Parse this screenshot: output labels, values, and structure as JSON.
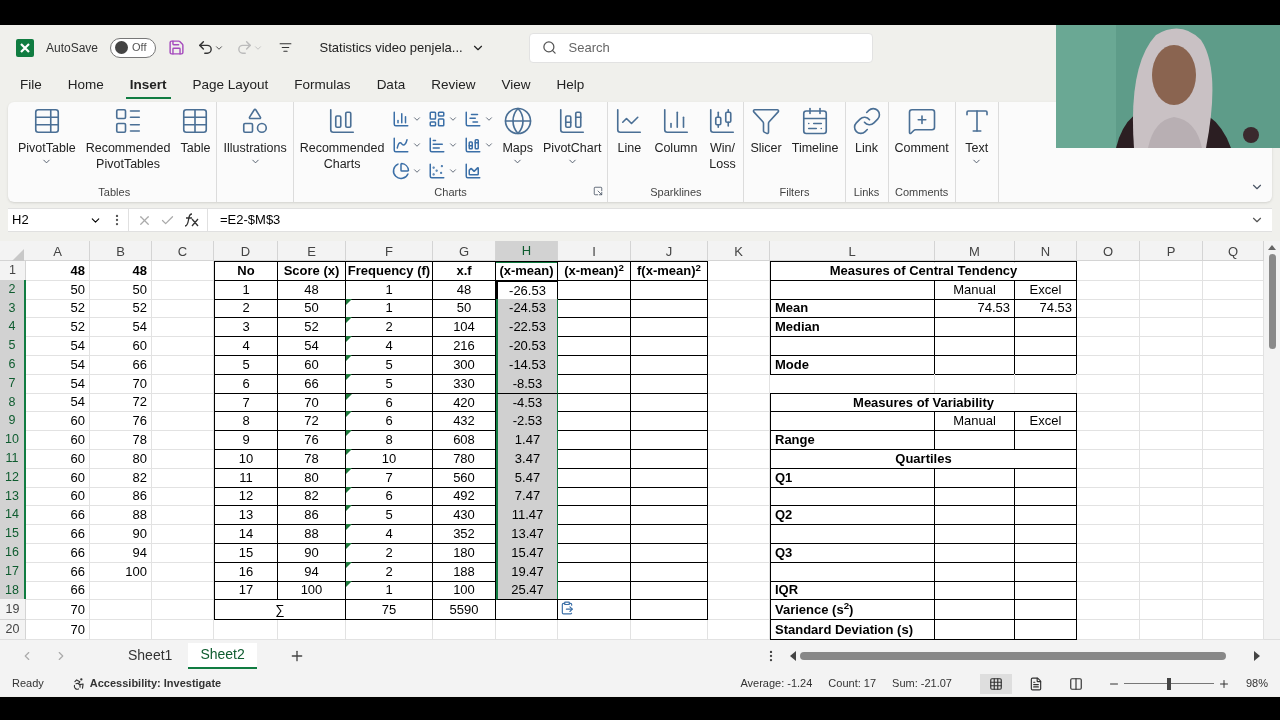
{
  "title_bar": {
    "autosave": {
      "label": "AutoSave",
      "on": false,
      "state_text": "Off"
    },
    "redo_disabled": true,
    "document": "Statistics video penjela...",
    "search": {
      "placeholder": "Search"
    }
  },
  "tabs": [
    {
      "label": "File",
      "selected": false
    },
    {
      "label": "Home",
      "selected": false
    },
    {
      "label": "Insert",
      "selected": true
    },
    {
      "label": "Page Layout",
      "selected": false
    },
    {
      "label": "Formulas",
      "selected": false
    },
    {
      "label": "Data",
      "selected": false
    },
    {
      "label": "Review",
      "selected": false
    },
    {
      "label": "View",
      "selected": false
    },
    {
      "label": "Help",
      "selected": false
    }
  ],
  "ribbon": {
    "groups": [
      {
        "label": "Tables",
        "items": [
          {
            "kind": "large",
            "label": "PivotTable",
            "dropdown": true
          },
          {
            "kind": "large",
            "label": "Recommended PivotTables",
            "dropdown": false
          },
          {
            "kind": "large",
            "label": "Table",
            "dropdown": false
          }
        ]
      },
      {
        "items": [
          {
            "kind": "large",
            "label": "Illustrations",
            "dropdown": true
          }
        ]
      },
      {
        "label": "Charts",
        "launcher": true,
        "items": [
          {
            "kind": "large",
            "label": "Recommended Charts",
            "dropdown": false
          },
          {
            "kind": "small",
            "dropdown": true
          },
          {
            "kind": "small",
            "dropdown": true
          },
          {
            "kind": "small",
            "dropdown": true
          },
          {
            "kind": "small",
            "dropdown": true
          },
          {
            "kind": "small",
            "dropdown": true
          },
          {
            "kind": "small",
            "dropdown": true
          },
          {
            "kind": "small",
            "dropdown": true
          },
          {
            "kind": "small",
            "dropdown": true
          },
          {
            "kind": "small",
            "dropdown": false
          },
          {
            "kind": "large",
            "label": "Maps",
            "dropdown": true
          },
          {
            "kind": "large",
            "label": "PivotChart",
            "dropdown": true
          }
        ]
      },
      {
        "label": "Sparklines",
        "items": [
          {
            "kind": "large",
            "label": "Line",
            "dropdown": false
          },
          {
            "kind": "large",
            "label": "Column",
            "dropdown": false
          },
          {
            "kind": "large",
            "label": "Win/ Loss",
            "dropdown": false
          }
        ]
      },
      {
        "label": "Filters",
        "items": [
          {
            "kind": "large",
            "label": "Slicer",
            "dropdown": false
          },
          {
            "kind": "large",
            "label": "Timeline",
            "dropdown": false
          }
        ]
      },
      {
        "label": "Links",
        "items": [
          {
            "kind": "large",
            "label": "Link",
            "dropdown": false
          }
        ]
      },
      {
        "label": "Comments",
        "items": [
          {
            "kind": "large",
            "label": "Comment",
            "dropdown": false
          }
        ]
      },
      {
        "items": [
          {
            "kind": "large",
            "label": "Text",
            "dropdown": true
          }
        ]
      }
    ]
  },
  "formula_bar": {
    "name_box": "H2",
    "formula": "=E2-$M$3"
  },
  "sheet": {
    "columns": [
      {
        "label": "A",
        "selected": false
      },
      {
        "label": "B",
        "selected": false
      },
      {
        "label": "C",
        "selected": false
      },
      {
        "label": "D",
        "selected": false
      },
      {
        "label": "E",
        "selected": false
      },
      {
        "label": "F",
        "selected": false
      },
      {
        "label": "G",
        "selected": false
      },
      {
        "label": "H",
        "selected": true
      },
      {
        "label": "I",
        "selected": false
      },
      {
        "label": "J",
        "selected": false
      },
      {
        "label": "K",
        "selected": false
      },
      {
        "label": "L",
        "selected": false
      },
      {
        "label": "M",
        "selected": false
      },
      {
        "label": "N",
        "selected": false
      },
      {
        "label": "O",
        "selected": false
      },
      {
        "label": "P",
        "selected": false
      },
      {
        "label": "Q",
        "selected": false
      }
    ],
    "rows": [
      {
        "number": "1",
        "selected": false,
        "active": false,
        "flag": false,
        "cells": [
          "48",
          "48",
          null,
          "No",
          "Score (x)",
          "Frequency (f)",
          "x.f",
          "(x-mean)",
          "(x-mean)$^{2}$",
          "f(x-mean)$^{2}$",
          null,
          "Measures of Central Tendency",
          null,
          null,
          null,
          null,
          null
        ]
      },
      {
        "number": "2",
        "selected": true,
        "active": true,
        "flag": false,
        "cells": [
          "50",
          "50",
          null,
          "1",
          "48",
          "1",
          "48",
          "-26.53",
          null,
          null,
          null,
          null,
          "Manual",
          "Excel",
          null,
          null,
          null
        ]
      },
      {
        "number": "3",
        "selected": true,
        "active": false,
        "flag": true,
        "cells": [
          "52",
          "52",
          null,
          "2",
          "50",
          "1",
          "50",
          "-24.53",
          null,
          null,
          null,
          "Mean",
          "74.53",
          "74.53",
          null,
          null,
          null
        ]
      },
      {
        "number": "4",
        "selected": true,
        "active": false,
        "flag": true,
        "cells": [
          "52",
          "54",
          null,
          "3",
          "52",
          "2",
          "104",
          "-22.53",
          null,
          null,
          null,
          "Median",
          null,
          null,
          null,
          null,
          null
        ]
      },
      {
        "number": "5",
        "selected": true,
        "active": false,
        "flag": true,
        "cells": [
          "54",
          "60",
          null,
          "4",
          "54",
          "4",
          "216",
          "-20.53",
          null,
          null,
          null,
          null,
          null,
          null,
          null,
          null,
          null
        ]
      },
      {
        "number": "6",
        "selected": true,
        "active": false,
        "flag": true,
        "cells": [
          "54",
          "66",
          null,
          "5",
          "60",
          "5",
          "300",
          "-14.53",
          null,
          null,
          null,
          "Mode",
          null,
          null,
          null,
          null,
          null
        ]
      },
      {
        "number": "7",
        "selected": true,
        "active": false,
        "flag": true,
        "cells": [
          "54",
          "70",
          null,
          "6",
          "66",
          "5",
          "330",
          "-8.53",
          null,
          null,
          null,
          null,
          null,
          null,
          null,
          null,
          null
        ]
      },
      {
        "number": "8",
        "selected": true,
        "active": false,
        "flag": true,
        "cells": [
          "54",
          "72",
          null,
          "7",
          "70",
          "6",
          "420",
          "-4.53",
          null,
          null,
          null,
          "Measures of Variability",
          null,
          null,
          null,
          null,
          null
        ]
      },
      {
        "number": "9",
        "selected": true,
        "active": false,
        "flag": true,
        "cells": [
          "60",
          "76",
          null,
          "8",
          "72",
          "6",
          "432",
          "-2.53",
          null,
          null,
          null,
          null,
          "Manual",
          "Excel",
          null,
          null,
          null
        ]
      },
      {
        "number": "10",
        "selected": true,
        "active": false,
        "flag": true,
        "cells": [
          "60",
          "78",
          null,
          "9",
          "76",
          "8",
          "608",
          "1.47",
          null,
          null,
          null,
          "Range",
          null,
          null,
          null,
          null,
          null
        ]
      },
      {
        "number": "11",
        "selected": true,
        "active": false,
        "flag": true,
        "cells": [
          "60",
          "80",
          null,
          "10",
          "78",
          "10",
          "780",
          "3.47",
          null,
          null,
          null,
          "Quartiles",
          null,
          null,
          null,
          null,
          null
        ]
      },
      {
        "number": "12",
        "selected": true,
        "active": false,
        "flag": true,
        "cells": [
          "60",
          "82",
          null,
          "11",
          "80",
          "7",
          "560",
          "5.47",
          null,
          null,
          null,
          "Q1",
          null,
          null,
          null,
          null,
          null
        ]
      },
      {
        "number": "13",
        "selected": true,
        "active": false,
        "flag": true,
        "cells": [
          "60",
          "86",
          null,
          "12",
          "82",
          "6",
          "492",
          "7.47",
          null,
          null,
          null,
          null,
          null,
          null,
          null,
          null,
          null
        ]
      },
      {
        "number": "14",
        "selected": true,
        "active": false,
        "flag": true,
        "cells": [
          "66",
          "88",
          null,
          "13",
          "86",
          "5",
          "430",
          "11.47",
          null,
          null,
          null,
          "Q2",
          null,
          null,
          null,
          null,
          null
        ]
      },
      {
        "number": "15",
        "selected": true,
        "active": false,
        "flag": true,
        "cells": [
          "66",
          "90",
          null,
          "14",
          "88",
          "4",
          "352",
          "13.47",
          null,
          null,
          null,
          null,
          null,
          null,
          null,
          null,
          null
        ]
      },
      {
        "number": "16",
        "selected": true,
        "active": false,
        "flag": true,
        "cells": [
          "66",
          "94",
          null,
          "15",
          "90",
          "2",
          "180",
          "15.47",
          null,
          null,
          null,
          "Q3",
          null,
          null,
          null,
          null,
          null
        ]
      },
      {
        "number": "17",
        "selected": true,
        "active": false,
        "flag": true,
        "cells": [
          "66",
          "100",
          null,
          "16",
          "94",
          "2",
          "188",
          "19.47",
          null,
          null,
          null,
          null,
          null,
          null,
          null,
          null,
          null
        ]
      },
      {
        "number": "18",
        "selected": true,
        "active": false,
        "flag": true,
        "cells": [
          "66",
          null,
          null,
          "17",
          "100",
          "1",
          "100",
          "25.47",
          null,
          null,
          null,
          "IQR",
          null,
          null,
          null,
          null,
          null
        ]
      },
      {
        "number": "19",
        "selected": false,
        "active": false,
        "flag": false,
        "cells": [
          "70",
          null,
          null,
          "∑",
          null,
          "75",
          "5590",
          null,
          null,
          null,
          null,
          "Varience (s$^{2}$)",
          null,
          null,
          null,
          null,
          null
        ]
      },
      {
        "number": "20",
        "selected": false,
        "active": false,
        "flag": false,
        "cells": [
          "70",
          null,
          null,
          null,
          null,
          null,
          null,
          null,
          null,
          null,
          null,
          "Standard Deviation (s)",
          null,
          null,
          null,
          null,
          null
        ]
      }
    ]
  },
  "sheet_tabs": [
    {
      "label": "Sheet1",
      "selected": false
    },
    {
      "label": "Sheet2",
      "selected": true
    }
  ],
  "status_bar": {
    "mode": "Ready",
    "accessibility": "Accessibility: Investigate",
    "average": "Average: -1.24",
    "count": "Count: 17",
    "sum": "Sum: -21.07",
    "views": [
      {
        "selected": true
      },
      {
        "selected": false
      },
      {
        "selected": false
      }
    ],
    "zoom": {
      "level": 0.5,
      "reading": "98%"
    }
  }
}
